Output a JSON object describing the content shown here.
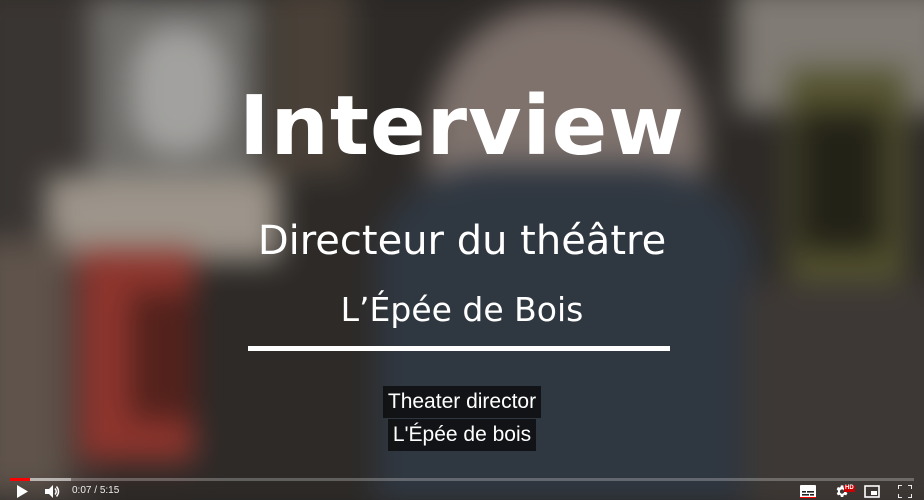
{
  "title_card": {
    "title": "Interview",
    "subtitle": "Directeur du théâtre",
    "name": "L’Épée de Bois"
  },
  "captions": {
    "lines": [
      "Theater director",
      "L'Épée de bois"
    ]
  },
  "player": {
    "current_time": "0:07",
    "time_separator": " / ",
    "duration": "5:15",
    "progress_fraction": 0.022,
    "buffered_fraction": 0.068,
    "hd_badge": "HD",
    "accent_color": "#ff0000",
    "icons": [
      "play-icon",
      "volume-icon",
      "subtitles-icon",
      "settings-icon",
      "miniplayer-icon",
      "fullscreen-icon"
    ]
  }
}
